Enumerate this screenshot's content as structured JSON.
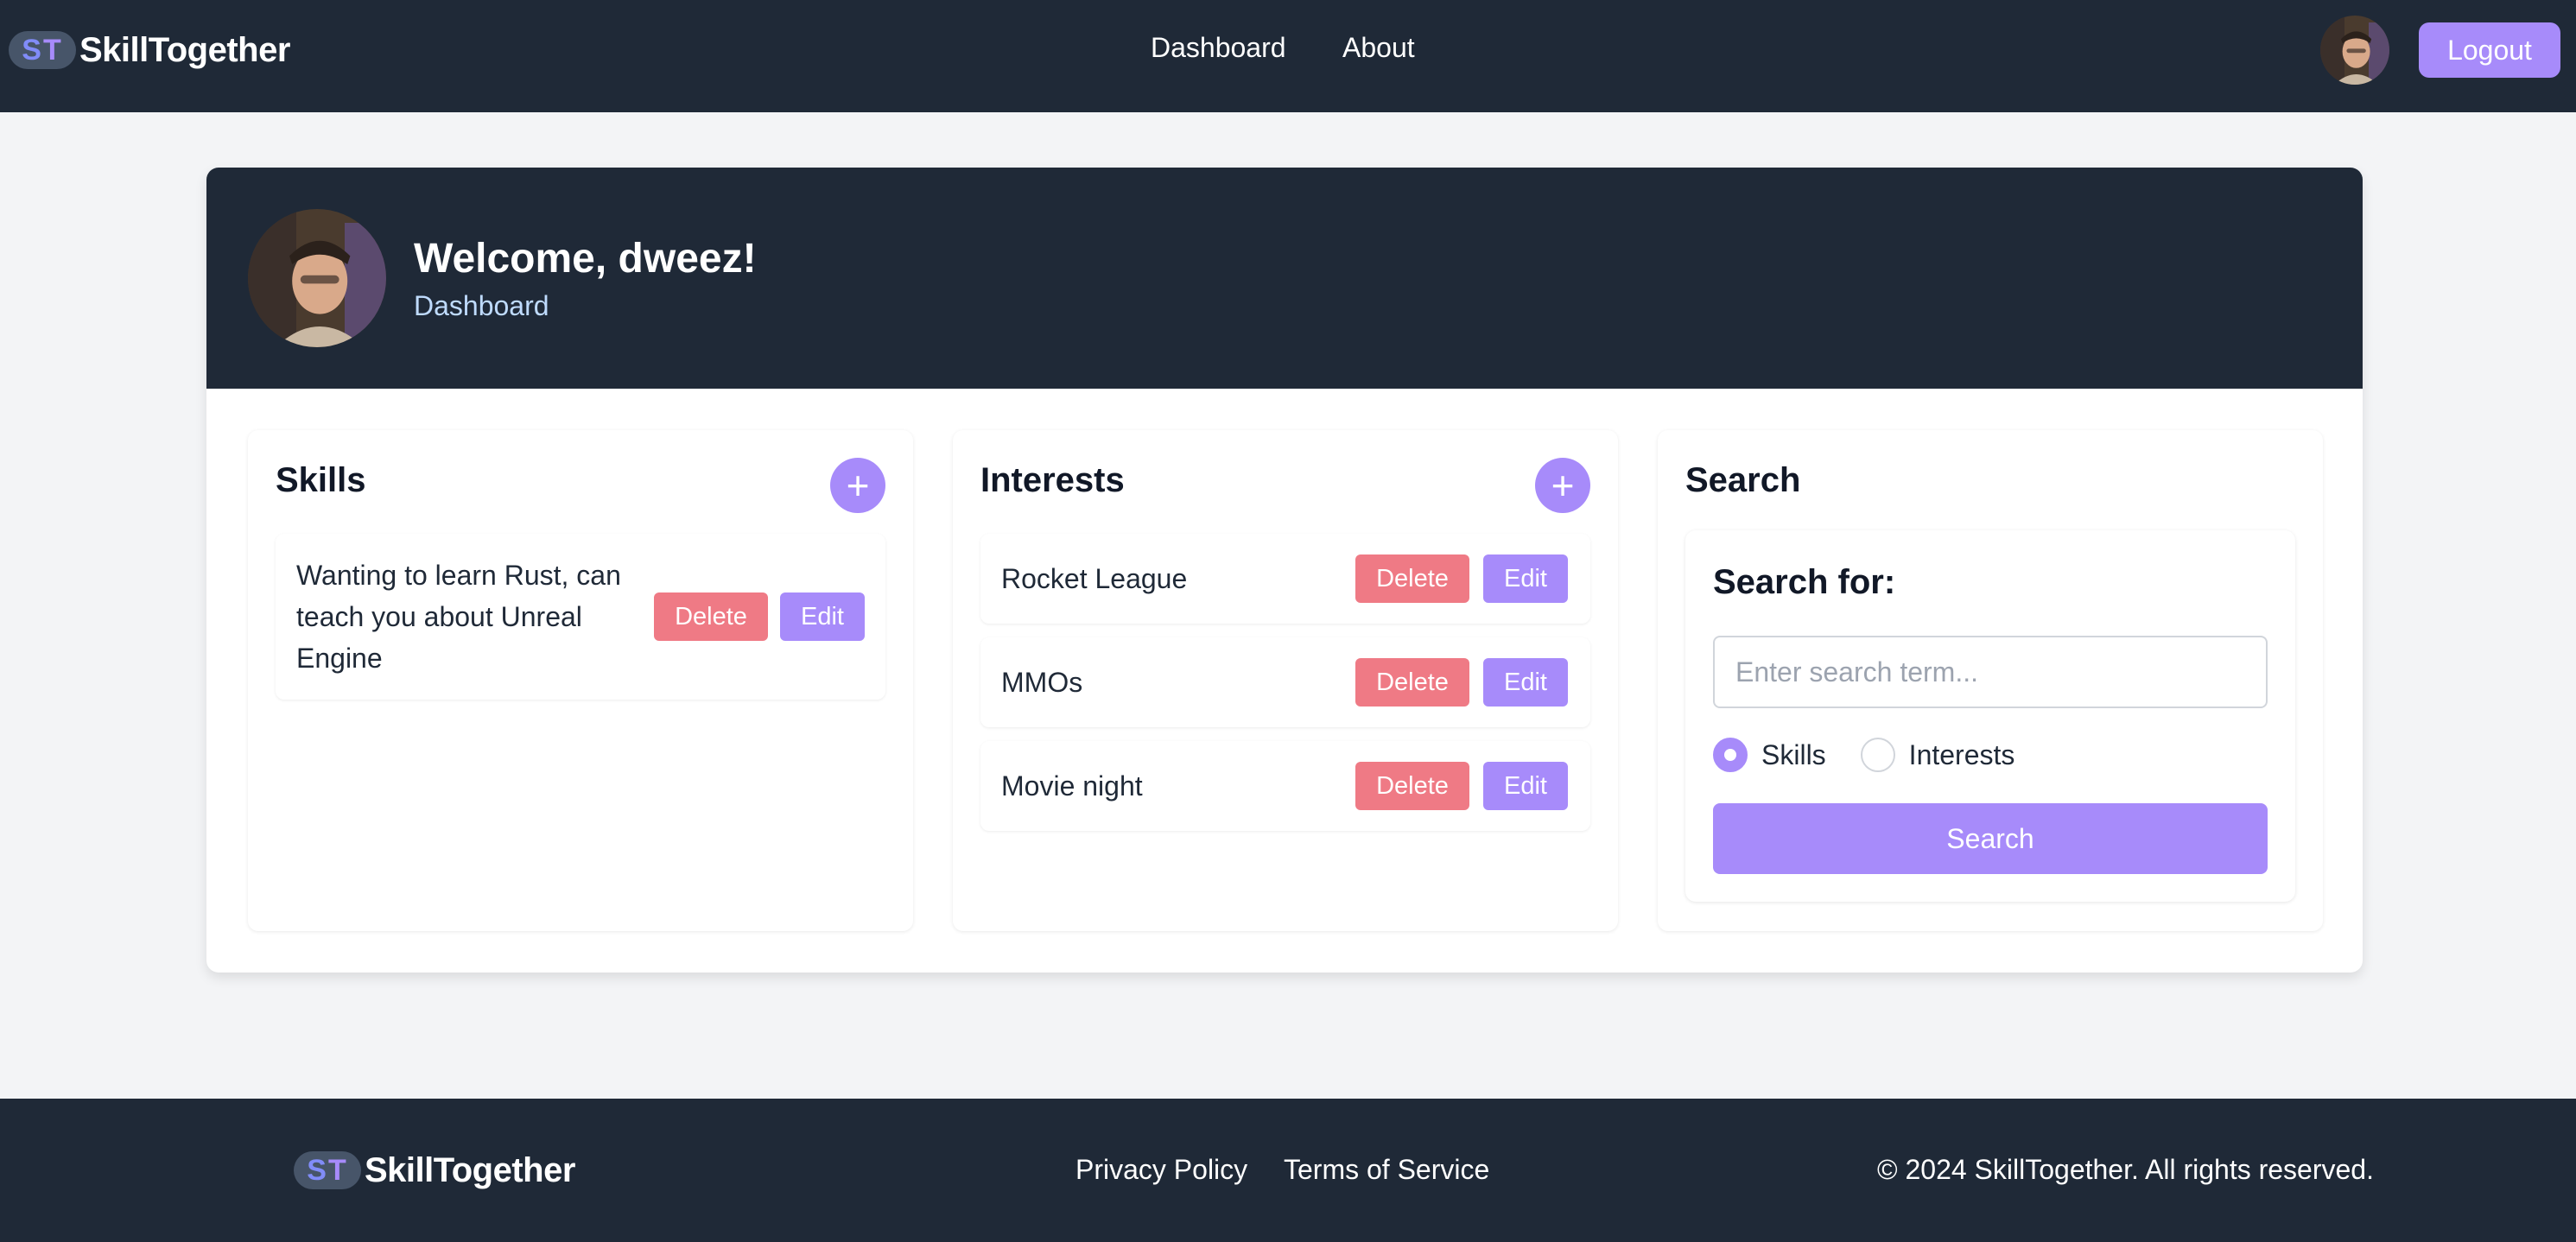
{
  "colors": {
    "navbar_bg": "#1f2937",
    "page_bg": "#f3f4f6",
    "accent": "#a78bfa",
    "danger": "#ef7a85",
    "hero_subtitle": "#bfdbfe"
  },
  "navbar": {
    "logo": {
      "icon": "skilltogether-logo-icon",
      "mark_s": "S",
      "mark_t": "T"
    },
    "brand_name": "SkillTogether",
    "links": [
      {
        "label": "Dashboard"
      },
      {
        "label": "About"
      }
    ],
    "avatar_icon": "user-avatar",
    "logout_label": "Logout"
  },
  "hero": {
    "avatar_icon": "user-avatar",
    "title": "Welcome, dweez!",
    "subtitle": "Dashboard"
  },
  "skills": {
    "title": "Skills",
    "add_icon": "plus-icon",
    "items": [
      {
        "text": "Wanting to learn Rust, can teach you about Unreal Engine",
        "delete_label": "Delete",
        "edit_label": "Edit"
      }
    ]
  },
  "interests": {
    "title": "Interests",
    "add_icon": "plus-icon",
    "items": [
      {
        "text": "Rocket League",
        "delete_label": "Delete",
        "edit_label": "Edit"
      },
      {
        "text": "MMOs",
        "delete_label": "Delete",
        "edit_label": "Edit"
      },
      {
        "text": "Movie night",
        "delete_label": "Delete",
        "edit_label": "Edit"
      }
    ]
  },
  "search": {
    "title": "Search",
    "label": "Search for:",
    "placeholder": "Enter search term...",
    "value": "",
    "options": [
      {
        "label": "Skills",
        "checked": true
      },
      {
        "label": "Interests",
        "checked": false
      }
    ],
    "button_label": "Search"
  },
  "footer": {
    "brand_name": "SkillTogether",
    "links": [
      {
        "label": "Privacy Policy"
      },
      {
        "label": "Terms of Service"
      }
    ],
    "copyright": "© 2024 SkillTogether. All rights reserved."
  }
}
